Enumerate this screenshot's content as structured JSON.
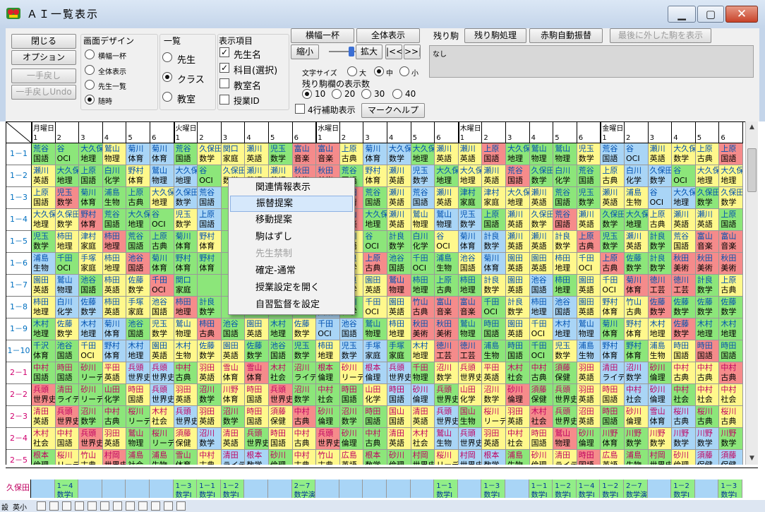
{
  "window": {
    "title": "ＡＩ一覧表示",
    "minimize": "▁",
    "maximize": "▢",
    "close": "✕"
  },
  "toolbar": {
    "close_label": "閉じる",
    "options_label": "オプション",
    "undo_label": "一手戻し",
    "undo_undo_label": "一手戻しUndo",
    "screen_design_title": "画面デザイン",
    "screen_design_options": [
      "横幅一杯",
      "全体表示",
      "先生一覧",
      "随時"
    ],
    "screen_design_selected": "随時",
    "list_title": "一覧",
    "list_options": [
      "先生",
      "クラス",
      "教室"
    ],
    "list_selected": "クラス",
    "display_items_title": "表示項目",
    "display_items": [
      {
        "label": "先生名",
        "checked": true
      },
      {
        "label": "科目(選択)",
        "checked": true
      },
      {
        "label": "教室名",
        "checked": false
      },
      {
        "label": "授業ID",
        "checked": false
      }
    ],
    "full_width_label": "横幅一杯",
    "show_all_label": "全体表示",
    "shrink_label": "縮小",
    "expand_label": "拡大",
    "prev_label": "|<<",
    "next_label": ">>|",
    "font_size_label": "文字サイズ",
    "font_size_options": [
      "大",
      "中",
      "小"
    ],
    "font_size_selected": "中",
    "remaining_count_label": "残り駒欄の表示数",
    "remaining_count_options": [
      "10",
      "20",
      "30",
      "40"
    ],
    "remaining_count_selected": "10",
    "four_row_label": "4行補助表示",
    "mark_help_label": "マークヘルプ",
    "remaining_label": "残り駒",
    "remaining_process_label": "残り駒処理",
    "red_auto_label": "赤駒自動振替",
    "last_removed_label": "最後に外した駒を表示",
    "remaining_value": "なし"
  },
  "grid": {
    "days": [
      "月曜日",
      "火曜日",
      "水曜日",
      "木曜日",
      "金曜日"
    ],
    "periods": [
      "1",
      "2",
      "3",
      "4",
      "5",
      "6"
    ],
    "rows": [
      {
        "label": "1－1",
        "color": "#0070c0"
      },
      {
        "label": "1－2",
        "color": "#0070c0"
      },
      {
        "label": "1－3",
        "color": "#0070c0"
      },
      {
        "label": "1－4",
        "color": "#0070c0"
      },
      {
        "label": "1－5",
        "color": "#0070c0"
      },
      {
        "label": "1－6",
        "color": "#0070c0"
      },
      {
        "label": "1－7",
        "color": "#0070c0"
      },
      {
        "label": "1－8",
        "color": "#0070c0"
      },
      {
        "label": "1－9",
        "color": "#0070c0"
      },
      {
        "label": "1－10",
        "color": "#0070c0"
      },
      {
        "label": "2－1",
        "color": "#d0006f"
      },
      {
        "label": "2－2",
        "color": "#d0006f"
      },
      {
        "label": "2－3",
        "color": "#d0006f"
      },
      {
        "label": "2－4",
        "color": "#d0006f"
      },
      {
        "label": "2－5",
        "color": "#d0006f"
      }
    ],
    "lessons": [
      [
        "荒谷 国語",
        "谷 OCⅠ",
        "大久保 地理",
        "鷲山 物理",
        "菊川 体育",
        "菊川 体育",
        "荒谷 国語",
        "久保田 数学",
        "関口 家庭",
        "瀬川 英語",
        "児玉 数学",
        "富山 音楽",
        "富山 音楽",
        "上原 古典",
        "菊川 体育",
        "大久保 数学",
        "大久保 地理",
        "瀬川 英語",
        "瀬川 英語",
        "上原 国語",
        "大久保 地理",
        "鷲山 物理",
        "鷲山 物理",
        "児玉 数学",
        "荒谷 国語",
        "谷 OCⅠ",
        "瀬川 英語",
        "大久保 数学",
        "上原 古典",
        "上原 国語"
      ],
      [
        "瀬川 英語",
        "大久保 地理",
        "上原 国語",
        "白川 化学",
        "野村 体育",
        "鷲山 物理",
        "大久保 地理",
        "谷 OCⅠ",
        "久保田 数学",
        "瀬川 英語",
        "瀬川 英語",
        "秋田 美術",
        "秋田 美術",
        "荒谷 国語",
        "野村 体育",
        "瀬川 英語",
        "児玉 数学",
        "大久保 地理",
        "大久保 地理",
        "瀬川 英語",
        "荒谷 国語",
        "久保田 数学",
        "白川 化学",
        "荒谷 国語",
        "上原 古典",
        "白川 化学",
        "久保田 数学",
        "谷 OCⅠ",
        "大久保 地理",
        "大久保 地理"
      ],
      [
        "上原 国語",
        "児玉 数学",
        "菊川 体育",
        "浦島 生物",
        "上原 古典",
        "大久保 地理",
        "久保田 数学",
        "荒谷 国語",
        "",
        "",
        "",
        "",
        "秋田 美術",
        "秋田 美術",
        "荒谷 国語",
        "瀬川 英語",
        "荒谷 国語",
        "瀬川 英語",
        "津村 家庭",
        "津村 家庭",
        "大久保 地理",
        "瀬川 英語",
        "荒谷 国語",
        "児玉 数学",
        "瀬川 英語",
        "浦島 生物",
        "谷 OCⅠ",
        "大久保 地理",
        "久保田 数学",
        "久保田 数学"
      ],
      [
        "大久保 地理",
        "久保田 数学",
        "野村 体育",
        "荒谷 国語",
        "大久保 地理",
        "谷 OCⅠ",
        "児玉 数学",
        "上原 国語",
        "",
        "",
        "",
        "",
        "富山 音楽",
        "富山 音楽",
        "大久保 地理",
        "瀬川 英語",
        "鷲山 物理",
        "鷲山 物理",
        "児玉 数学",
        "上原 国語",
        "瀬川 英語",
        "久保田 数学",
        "荒谷 国語",
        "瀬川 英語",
        "久保田 数学",
        "大久保 地理",
        "上原 古典",
        "瀬川 英語",
        "瀬川 英語",
        "上原 国語"
      ],
      [
        "児玉 数学",
        "柿田 地理",
        "津村 家庭",
        "柿田 地理",
        "荒谷 国語",
        "上原 古典",
        "菊川 体育",
        "野村 体育",
        "",
        "",
        "",
        "",
        "柿田 地理",
        "瀬川 英語",
        "谷 OCⅠ",
        "計良 数学",
        "白川 化学",
        "谷 OCⅠ",
        "菊川 体育",
        "計良 数学",
        "瀬川 英語",
        "瀬川 英語",
        "計良 数学",
        "上原 古典",
        "児玉 数学",
        "瀬川 英語",
        "計良 数学",
        "荒谷 国語",
        "富山 音楽",
        "富山 音楽"
      ],
      [
        "浦島 生物",
        "千田 OCⅠ",
        "手塚 家庭",
        "柿田 地理",
        "池谷 国語",
        "菊川 体育",
        "野村 体育",
        "野村 体育",
        "",
        "",
        "",
        "",
        "計良 数学",
        "計良 数学",
        "上原 古典",
        "池谷 国語",
        "千田 OCⅠ",
        "浦島 生物",
        "池谷 国語",
        "菊川 体育",
        "園田 英語",
        "園田 英語",
        "柿田 地理",
        "千田 OCⅠ",
        "上原 古典",
        "佐藤 数学",
        "計良 数学",
        "秋田 美術",
        "秋田 美術",
        "秋田 美術"
      ],
      [
        "園田 英語",
        "鷲山 物理",
        "池谷 国語",
        "柿田 英語",
        "佐藤 数学",
        "千田 OCⅠ",
        "関口 家庭",
        "",
        "",
        "",
        "",
        "",
        "園田 英語",
        "計良 数学",
        "園田 英語",
        "鷲山 物理",
        "柿田 地理",
        "上原 古典",
        "柿田 地理",
        "計良 数学",
        "園田 英語",
        "池谷 国語",
        "柿田 地理",
        "園田 英語",
        "千田 OCⅠ",
        "菊川 体育",
        "徳川 工芸",
        "徳川 工芸",
        "計良 数学",
        "上原 古典"
      ],
      [
        "柿田 地理",
        "白川 化学",
        "佐藤 数学",
        "柿田 英語",
        "手塚 家庭",
        "池谷 国語",
        "柿田 地理",
        "計良 数学",
        "",
        "",
        "",
        "",
        "池谷 国語",
        "白川 化学",
        "千田 OCⅠ",
        "園田 英語",
        "竹山 古典",
        "富山 音楽",
        "富山 音楽",
        "千田 OCⅠ",
        "計良 数学",
        "柿田 地理",
        "池谷 国語",
        "園田 英語",
        "野村 体育",
        "竹山 古典",
        "佐藤 数学",
        "佐藤 数学",
        "佐藤 数学",
        "佐藤 数学"
      ],
      [
        "木村 地理",
        "佐藤 数学",
        "木村 地理",
        "菊川 体育",
        "池谷 国語",
        "児玉 数学",
        "鷲山 物理",
        "柿田 古典",
        "池谷 国語",
        "園田 英語",
        "木村 地理",
        "佐藤 数学",
        "千田 OCⅠ",
        "池谷 国語",
        "鷲山 物理",
        "柿田 地理",
        "秋田 美術",
        "秋田 美術",
        "鷲山 物理",
        "時田 国語",
        "園田 英語",
        "千田 OCⅠ",
        "木村 地理",
        "鷲山 物理",
        "菊川 体育",
        "野村 体育",
        "木村 地理",
        "佐藤 数学",
        "木村 地理",
        "木村 地理"
      ],
      [
        "千沢 体育",
        "池谷 国語",
        "千田 OCⅠ",
        "野村 体育",
        "木村 地理",
        "園田 英語",
        "木村 生物",
        "佐藤 数学",
        "園田 英語",
        "佐藤 数学",
        "池谷 国語",
        "児玉 数学",
        "柿田 地理",
        "児玉 数学",
        "手塚 家庭",
        "手塚 家庭",
        "木村 地理",
        "徳川 工芸",
        "徳川 工芸",
        "浦島 生物",
        "時田 国語",
        "千田 OCⅠ",
        "児玉 数学",
        "浦島 生物",
        "野村 体育",
        "野村 体育",
        "浦島 生物",
        "時田 国語",
        "時田 国語",
        "時田 国語"
      ],
      [
        "中村 国語",
        "時田 国語",
        "砂川 リーデ",
        "平田 英語",
        "兵頭 世界史",
        "兵頭 世界史",
        "中村 古典",
        "羽田 英語",
        "雪山 体育",
        "雪山 体育",
        "木村 社会",
        "沼川 ライテ",
        "根本 倫理",
        "砂川 リーデ",
        "根本 倫理",
        "兵頭 世界史",
        "千田 物理",
        "沼川 数学",
        "兵頭 世界史",
        "平田 英語",
        "木村 社会",
        "中村 古典",
        "須藤 保健",
        "羽田 英語",
        "清田 ライテ",
        "沼川 数学",
        "砂川 倫理",
        "中村 古典",
        "中村 古典",
        "中村 古典"
      ],
      [
        "兵頭 世界史",
        "清田 ライテ",
        "砂川 リーデ",
        "山田 化学",
        "時田 国語",
        "兵頭 世界史",
        "羽田 英語",
        "沼川 数学",
        "川野 体育",
        "時田 国語",
        "兵頭 世界史",
        "沼川 数学",
        "中村 社会",
        "時田 国語",
        "山田 化学",
        "時田 国語",
        "砂川 倫理",
        "兵頭 世界史",
        "山田 化学",
        "沼川 数学",
        "砂川 倫理",
        "須藤 保健",
        "兵頭 世界史",
        "羽田 英語",
        "時田 国語",
        "中村 社会",
        "砂川 倫理",
        "中村 社会",
        "中村 社会",
        "中村 社会"
      ],
      [
        "清田 英語",
        "兵頭 世界史",
        "沼川 数学",
        "中村 古典",
        "桜川 リーデ",
        "木村 社会",
        "兵頭 世界史",
        "羽田 英語",
        "沼川 数学",
        "時田 国語",
        "須藤 保健",
        "中村 古典",
        "砂川 倫理",
        "沼川 数学",
        "時田 国語",
        "国山 国語",
        "清田 英語",
        "兵頭 世界史",
        "国山 生物",
        "桜川 リーデ",
        "羽田 英語",
        "木村 社会",
        "兵頭 世界史",
        "沼田 英語",
        "時田 国語",
        "砂川 倫理",
        "雪山 体育",
        "桜川 古典",
        "桜川 古典",
        "桜川 古典"
      ],
      [
        "木村 社会",
        "中村 国語",
        "兵頭 世界史",
        "羽田 英語",
        "鷲山 物理",
        "桜川 リーデ",
        "須藤 保健",
        "沼川 数学",
        "清田 英語",
        "兵頭 世界史",
        "時田 国語",
        "中村 古典",
        "兵頭 世界史",
        "砂川 倫理",
        "中村 古典",
        "清田 英語",
        "木村 社会",
        "鷲山 生物",
        "兵頭 世界史",
        "羽田 英語",
        "中村 社会",
        "時田 国語",
        "鷲山 物理",
        "砂川 倫理",
        "川野 体育",
        "川野 数学",
        "川野 数学",
        "川野 数学",
        "川野 数学",
        "川野 数学"
      ],
      [
        "根本 倫理",
        "桜川 リーデ",
        "竹山 古典",
        "村岡 世界史",
        "浦島 社会",
        "浦島 生物",
        "雪山 体育",
        "中村 古典",
        "清田 ライテ",
        "根本 数学",
        "砂川 倫理",
        "中村 古典",
        "竹山 古典",
        "広島 英語",
        "根本 数学",
        "砂川 倫理",
        "村岡 世界史",
        "桜川 リーデ",
        "村岡 世界史",
        "根本 数学",
        "浦島 生物",
        "砂川 倫理",
        "清田 ライテ",
        "時田 国語",
        "広島 英語",
        "浦島 生物",
        "村岡 世界史",
        "砂川 倫理",
        "須藤 保健",
        "須藤 保健"
      ]
    ],
    "colors": {
      "green": "#8ce67a",
      "yellow": "#fff88c",
      "blue": "#a9d5f6",
      "red": "#f58b8b",
      "dark": "#2f7d28"
    }
  },
  "bottom_strip": {
    "label": "久保田",
    "items": [
      {
        "col": 1,
        "top": "1－4",
        "bottom": "数学Ⅰ"
      },
      {
        "col": 6,
        "top": "1－3",
        "bottom": "数学Ⅰ"
      },
      {
        "col": 7,
        "top": "1－1",
        "bottom": "数学Ⅰ"
      },
      {
        "col": 8,
        "top": "1－2",
        "bottom": "数学Ⅰ"
      },
      {
        "col": 11,
        "top": "2－7",
        "bottom": "数学演"
      },
      {
        "col": 17,
        "top": "1－1",
        "bottom": "数学Ⅰ"
      },
      {
        "col": 19,
        "top": "1－3",
        "bottom": "数学Ⅰ"
      },
      {
        "col": 21,
        "top": "1－1",
        "bottom": "数学Ⅰ"
      },
      {
        "col": 22,
        "top": "1－2",
        "bottom": "数学Ⅰ"
      },
      {
        "col": 23,
        "top": "1－4",
        "bottom": "数学Ⅰ"
      },
      {
        "col": 24,
        "top": "1－2",
        "bottom": "数学Ⅰ"
      },
      {
        "col": 25,
        "top": "2－7",
        "bottom": "数学演"
      },
      {
        "col": 27,
        "top": "1－2",
        "bottom": "数学Ⅰ"
      },
      {
        "col": 29,
        "top": "1－3",
        "bottom": "数学Ⅰ"
      }
    ]
  },
  "statusbar": {
    "left_label": "設",
    "mode_label": "英小"
  },
  "context_menu": {
    "items": [
      {
        "label": "関連情報表示",
        "state": "normal"
      },
      {
        "label": "振替提案",
        "state": "highlight"
      },
      {
        "label": "移動提案",
        "state": "normal"
      },
      {
        "label": "駒はずし",
        "state": "normal"
      },
      {
        "label": "先生禁制",
        "state": "disabled"
      },
      {
        "label": "確定-通常",
        "state": "normal"
      },
      {
        "label": "授業設定を開く",
        "state": "normal"
      },
      {
        "label": "自習監督を設定",
        "state": "normal"
      }
    ]
  }
}
